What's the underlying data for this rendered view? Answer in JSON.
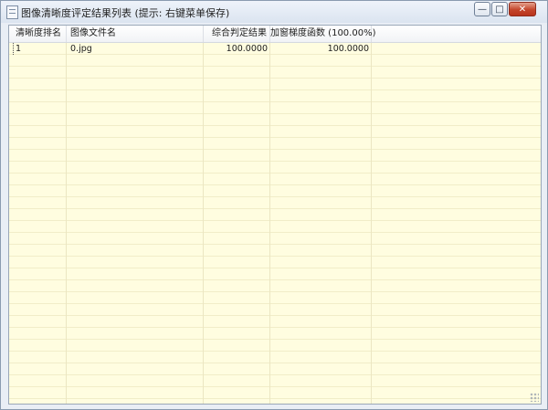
{
  "window": {
    "title": "图像清晰度评定结果列表 (提示: 右键菜单保存)",
    "minimize_glyph": "—",
    "maximize_glyph": "□",
    "close_glyph": "✕"
  },
  "table": {
    "columns": [
      "清晰度排名",
      "图像文件名",
      "综合判定结果",
      "加窗梯度函数 (100.00%)"
    ],
    "rows": [
      {
        "rank": "1",
        "filename": "0.jpg",
        "result": "100.0000",
        "gradient": "100.0000"
      }
    ]
  },
  "colors": {
    "list_background": "#fffde0",
    "row_line": "#f1edc8",
    "close_button": "#c4452b"
  },
  "icons": {
    "app": "list-window-icon",
    "minimize": "minimize-icon",
    "maximize": "maximize-icon",
    "close": "close-icon"
  }
}
